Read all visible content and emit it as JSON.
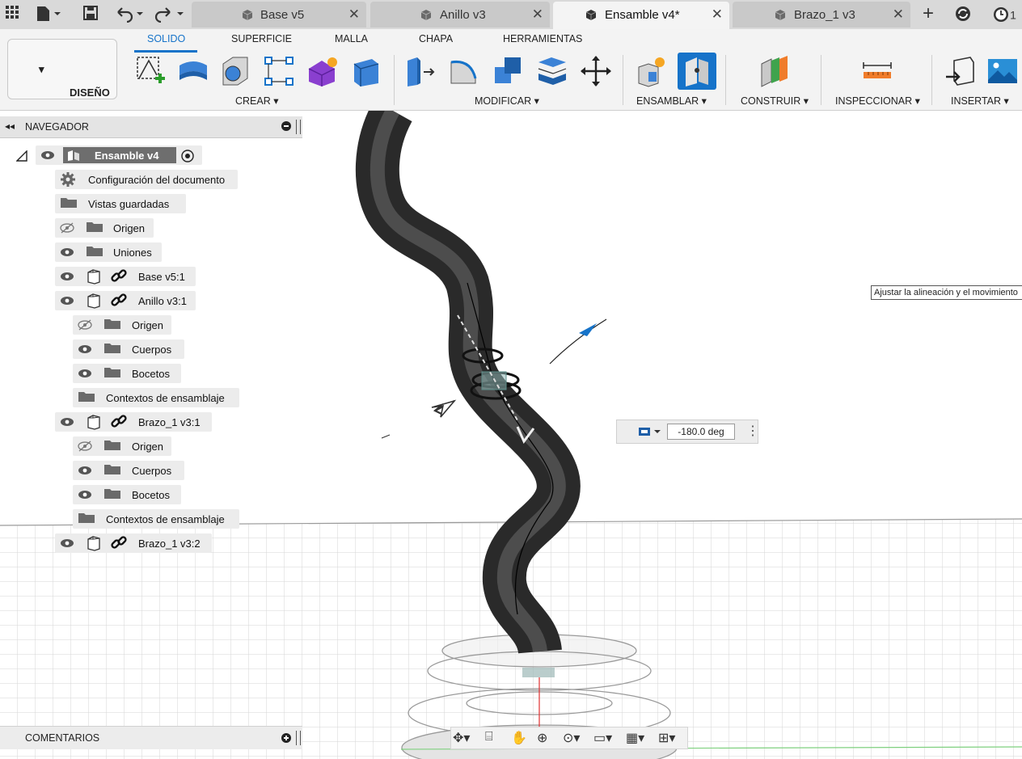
{
  "tabs": [
    {
      "label": "Base v5",
      "active": false
    },
    {
      "label": "Anillo v3",
      "active": false
    },
    {
      "label": "Ensamble v4*",
      "active": true
    },
    {
      "label": "Brazo_1 v3",
      "active": false
    }
  ],
  "top_right": {
    "job_count": "1"
  },
  "ribbon": {
    "workspace_label": "DISEÑO",
    "tabs": [
      "SOLIDO",
      "SUPERFICIE",
      "MALLA",
      "CHAPA",
      "HERRAMIENTAS"
    ],
    "groups": [
      "CREAR",
      "MODIFICAR",
      "ENSAMBLAR",
      "CONSTRUIR",
      "INSPECCIONAR",
      "INSERTAR"
    ]
  },
  "navigator": {
    "title": "NAVEGADOR",
    "root": "Ensamble v4",
    "items": [
      "Configuración del documento",
      "Vistas guardadas",
      "Origen",
      "Uniones",
      "Base v5:1",
      "Anillo v3:1",
      "Origen",
      "Cuerpos",
      "Bocetos",
      "Contextos de ensamblaje",
      "Brazo_1 v3:1",
      "Origen",
      "Cuerpos",
      "Bocetos",
      "Contextos de ensamblaje",
      "Brazo_1 v3:2"
    ]
  },
  "comments": {
    "title": "COMENTARIOS"
  },
  "canvas": {
    "tooltip": "Ajustar la alineación y el movimiento",
    "angle_value": "-180.0 deg"
  },
  "colors": {
    "accent": "#1673c9",
    "model": "#3a3a3a"
  }
}
